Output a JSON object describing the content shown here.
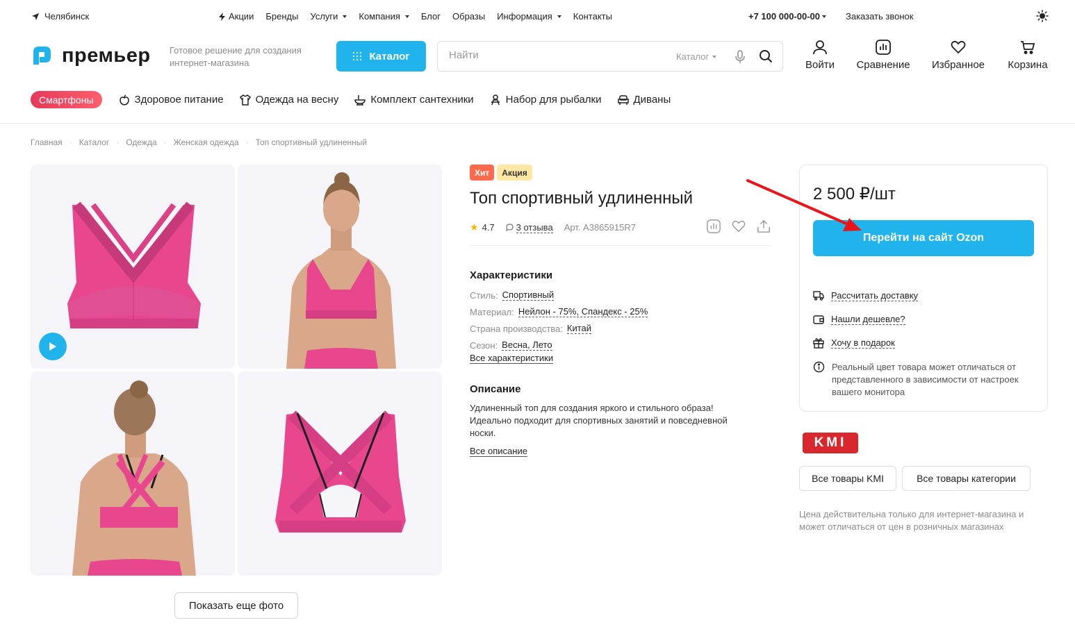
{
  "topbar": {
    "city": "Челябинск",
    "nav": [
      {
        "label": "Акции",
        "icon": "bolt-icon",
        "dropdown": false
      },
      {
        "label": "Бренды",
        "dropdown": false
      },
      {
        "label": "Услуги",
        "dropdown": true
      },
      {
        "label": "Компания",
        "dropdown": true
      },
      {
        "label": "Блог",
        "dropdown": false
      },
      {
        "label": "Образы",
        "dropdown": false
      },
      {
        "label": "Информация",
        "dropdown": true
      },
      {
        "label": "Контакты",
        "dropdown": false
      }
    ],
    "phone": "+7 100 000-00-00",
    "callback": "Заказать звонок"
  },
  "header": {
    "logo_text": "премьер",
    "tagline": "Готовое решение для создания интернет-магазина",
    "catalog_button": "Каталог",
    "search": {
      "placeholder": "Найти",
      "scope": "Каталог"
    },
    "actions": {
      "login": "Войти",
      "compare": "Сравнение",
      "favorites": "Избранное",
      "cart": "Корзина"
    }
  },
  "promo": {
    "pill": "Смартфоны",
    "items": [
      "Здоровое питание",
      "Одежда на весну",
      "Комплект сантехники",
      "Набор для рыбалки",
      "Диваны"
    ]
  },
  "breadcrumb": [
    "Главная",
    "Каталог",
    "Одежда",
    "Женская одежда",
    "Топ спортивный удлиненный"
  ],
  "gallery": {
    "more_button": "Показать еще фото"
  },
  "product": {
    "badges": {
      "hit": "Хит",
      "sale": "Акция"
    },
    "title": "Топ спортивный удлиненный",
    "rating": "4.7",
    "reviews": "3 отзыва",
    "sku": "Арт. A3865915R7",
    "characteristics_title": "Характеристики",
    "characteristics": [
      {
        "key": "Стиль:",
        "value": "Спортивный"
      },
      {
        "key": "Материал:",
        "value": "Нейлон - 75%, Спандекс - 25%"
      },
      {
        "key": "Страна производства:",
        "value": "Китай"
      },
      {
        "key": "Сезон:",
        "value": "Весна, Лето"
      }
    ],
    "all_characteristics": "Все характеристики",
    "description_title": "Описание",
    "description": "Удлиненный топ для создания яркого и стильного образа! Идеально подходит для спортивных занятий и повседневной носки.",
    "all_description": "Все описание"
  },
  "buy": {
    "price": "2 500 ₽/шт",
    "ozon_button": "Перейти на сайт Ozon",
    "delivery": "Рассчитать доставку",
    "cheaper": "Нашли дешевле?",
    "gift": "Хочу в подарок",
    "color_note": "Реальный цвет товара может отличаться от представленного в зависимости от настроек вашего монитора"
  },
  "brand": {
    "logo_text": "KMI",
    "all_brand": "Все товары KMI",
    "all_category": "Все товары категории",
    "disclaimer": "Цена действительна только для интернет-магазина и может отличаться от цен в розничных магазинах"
  },
  "colors": {
    "accent": "#21b4ec",
    "product_pink": "#e8478e",
    "hit": "#ff6a4d",
    "sale": "#ffe8a3",
    "arrow": "#e8161b"
  }
}
